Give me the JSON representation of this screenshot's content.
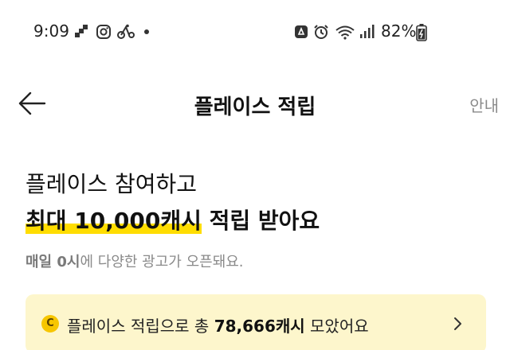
{
  "status_bar": {
    "time": "9:09",
    "battery_percent": "82%",
    "left_icons": [
      "square-steps-icon",
      "instagram-icon",
      "cycling-app-icon",
      "notification-dot"
    ],
    "right_icons": [
      "recycle-notification-icon",
      "alarm-icon",
      "wifi-icon",
      "signal-icon",
      "battery-charging-icon"
    ]
  },
  "header": {
    "title": "플레이스 적립",
    "info_label": "안내",
    "back_icon": "arrow-left-icon"
  },
  "hero": {
    "line1": "플레이스 참여하고",
    "highlight": "최대 10,000캐시",
    "line2_rest": " 적립 받아요",
    "sub_bold": "매일 0시",
    "sub_rest": "에 다양한 광고가 오픈돼요."
  },
  "summary": {
    "coin_symbol": "C",
    "prefix": "플레이스 적립으로 총 ",
    "amount": "78,666캐시",
    "suffix": " 모았어요"
  },
  "colors": {
    "accent_yellow": "#ffdd00",
    "card_background": "#fdf6cc",
    "coin": "#f7c600",
    "muted_text": "#8a8a8a"
  }
}
